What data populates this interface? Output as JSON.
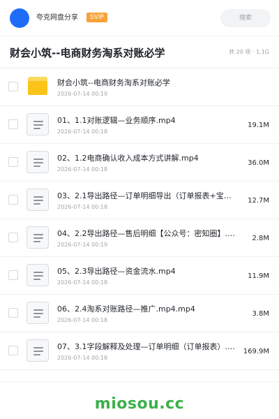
{
  "header": {
    "user_name": "夸克网盘分享",
    "badge": "SVIP",
    "search_placeholder": "搜索",
    "avatar_color": "#1f6cf9"
  },
  "folder": {
    "title": "财会小筑--电商财务淘系对账必学",
    "meta": "共 20 项 · 1.1G"
  },
  "files": [
    {
      "type": "folder",
      "icon": "folder-icon",
      "name": "财会小筑--电商财务淘系对账必学",
      "date": "2026-07-14 00:19",
      "size": ""
    },
    {
      "type": "file",
      "icon": "document-icon",
      "name": "01、1.1对账逻辑—业务顺序.mp4",
      "date": "2026-07-14 00:18",
      "size": "19.1M"
    },
    {
      "type": "file",
      "icon": "document-icon",
      "name": "02、1.2电商确认收入成本方式讲解.mp4",
      "date": "2026-07-14 00:18",
      "size": "36.0M"
    },
    {
      "type": "file",
      "icon": "document-icon",
      "name": "03、2.1导出路径—订单明细导出（订单报表+宝贝…",
      "date": "2026-07-14 00:18",
      "size": "12.7M"
    },
    {
      "type": "file",
      "icon": "document-icon",
      "name": "04、2.2导出路径—售后明细【公众号：密知圈】.…",
      "date": "2026-07-14 00:19",
      "size": "2.8M"
    },
    {
      "type": "file",
      "icon": "document-icon",
      "name": "05、2.3导出路径—资金流水.mp4",
      "date": "2026-07-14 00:18",
      "size": "11.9M"
    },
    {
      "type": "file",
      "icon": "document-icon",
      "name": "06、2.4淘系对账路径—推广.mp4.mp4",
      "date": "2026-07-14 00:18",
      "size": "3.8M"
    },
    {
      "type": "file",
      "icon": "document-icon",
      "name": "07、3.1字段解释及处理—订单明细（订单报表）.…",
      "date": "2026-07-14 00:18",
      "size": "169.9M"
    }
  ],
  "watermark": "miosou.cc",
  "colors": {
    "folder": "#fcc419",
    "svip": "#f7a23b",
    "watermark": "#3cb04b"
  }
}
